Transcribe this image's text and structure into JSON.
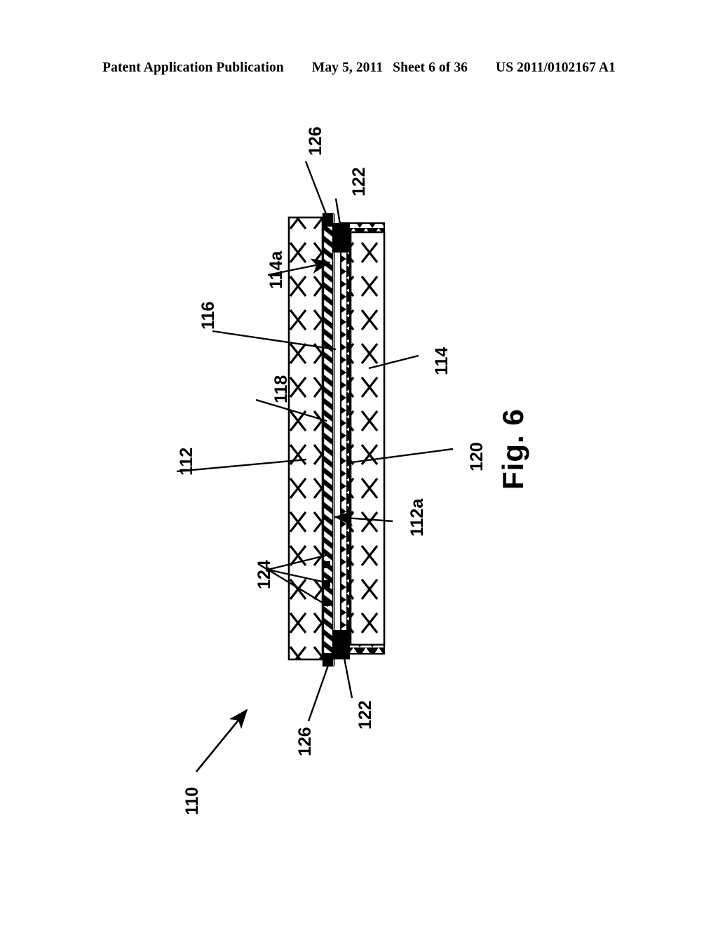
{
  "header": {
    "publication": "Patent Application Publication",
    "date": "May 5, 2011",
    "sheet": "Sheet 6 of 36",
    "patent_number": "US 2011/0102167 A1"
  },
  "figure": {
    "title": "Fig. 6",
    "assembly_label": "110",
    "labels": [
      {
        "id": "126-top",
        "text": "126"
      },
      {
        "id": "122-top",
        "text": "122"
      },
      {
        "id": "114a",
        "text": "114a"
      },
      {
        "id": "116",
        "text": "116"
      },
      {
        "id": "118",
        "text": "118"
      },
      {
        "id": "112",
        "text": "112"
      },
      {
        "id": "114",
        "text": "114"
      },
      {
        "id": "120",
        "text": "120"
      },
      {
        "id": "112a",
        "text": "112a"
      },
      {
        "id": "124",
        "text": "124"
      },
      {
        "id": "126-bot",
        "text": "126"
      },
      {
        "id": "122-bot",
        "text": "122"
      }
    ],
    "colors": {
      "line": "#000000",
      "fill": "#ffffff",
      "solid_block": "#000000"
    }
  }
}
